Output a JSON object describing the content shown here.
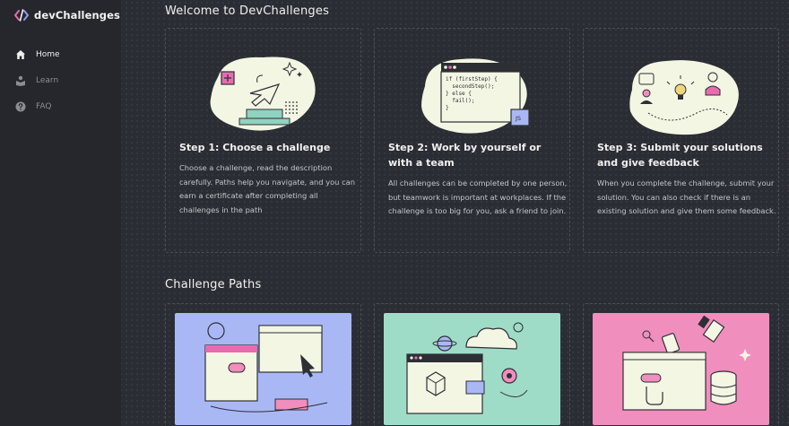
{
  "brand": {
    "name": "devChallenges"
  },
  "sidebar": {
    "items": [
      {
        "label": "Home",
        "icon": "home-icon",
        "active": true
      },
      {
        "label": "Learn",
        "icon": "learn-icon",
        "active": false
      },
      {
        "label": "FAQ",
        "icon": "question-icon",
        "active": false
      }
    ]
  },
  "welcome": {
    "title": "Welcome to DevChallenges",
    "steps": [
      {
        "title": "Step 1: Choose a challenge",
        "description": "Choose a challenge, read the description carefully. Paths help you navigate, and you can earn a certificate after completing all challenges in the path",
        "illustration": "choose-challenge-illustration"
      },
      {
        "title": "Step 2: Work by yourself or with a team",
        "description": "All challenges can be completed by one person, but teamwork is important at workplaces. If the challenge is too big for you, ask a friend to join.",
        "illustration": "code-editor-illustration",
        "code_lines": [
          "if (firstStep) {",
          "  secondStep();",
          "} else {",
          "  fail();",
          "}"
        ],
        "code_badge": "JS"
      },
      {
        "title": "Step 3: Submit your solutions and give feedback",
        "description": "When you complete the challenge, submit your solution. You can also check if there is an existing solution and give them some feedback.",
        "illustration": "feedback-illustration"
      }
    ]
  },
  "paths": {
    "title": "Challenge Paths",
    "cards": [
      {
        "illustration": "frontend-path-illustration",
        "bg_color": "#a9b8f5"
      },
      {
        "illustration": "fullstack-path-illustration",
        "bg_color": "#9fdcc7"
      },
      {
        "illustration": "backend-path-illustration",
        "bg_color": "#f08ebe"
      }
    ]
  },
  "colors": {
    "background": "#2a2d33",
    "sidebar": "#25272c",
    "art_cream": "#f4f6e4",
    "accent_pink": "#e86bb0"
  }
}
